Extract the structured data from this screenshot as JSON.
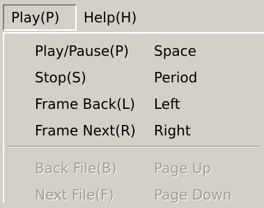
{
  "menubar": {
    "items": [
      {
        "label": "Play(P)"
      },
      {
        "label": "Help(H)"
      }
    ]
  },
  "play_menu": {
    "items": [
      {
        "label": "Play/Pause(P)",
        "shortcut": "Space",
        "enabled": true
      },
      {
        "label": "Stop(S)",
        "shortcut": "Period",
        "enabled": true
      },
      {
        "label": "Frame Back(L)",
        "shortcut": "Left",
        "enabled": true
      },
      {
        "label": "Frame Next(R)",
        "shortcut": "Right",
        "enabled": true
      },
      {
        "label": "Back File(B)",
        "shortcut": "Page Up",
        "enabled": false
      },
      {
        "label": "Next File(F)",
        "shortcut": "Page Down",
        "enabled": false
      }
    ]
  },
  "colors": {
    "face": "#d4d0c8",
    "text": "#000000",
    "disabled_text": "#a09c94",
    "highlight": "#ffffff",
    "shadow": "#808080"
  }
}
